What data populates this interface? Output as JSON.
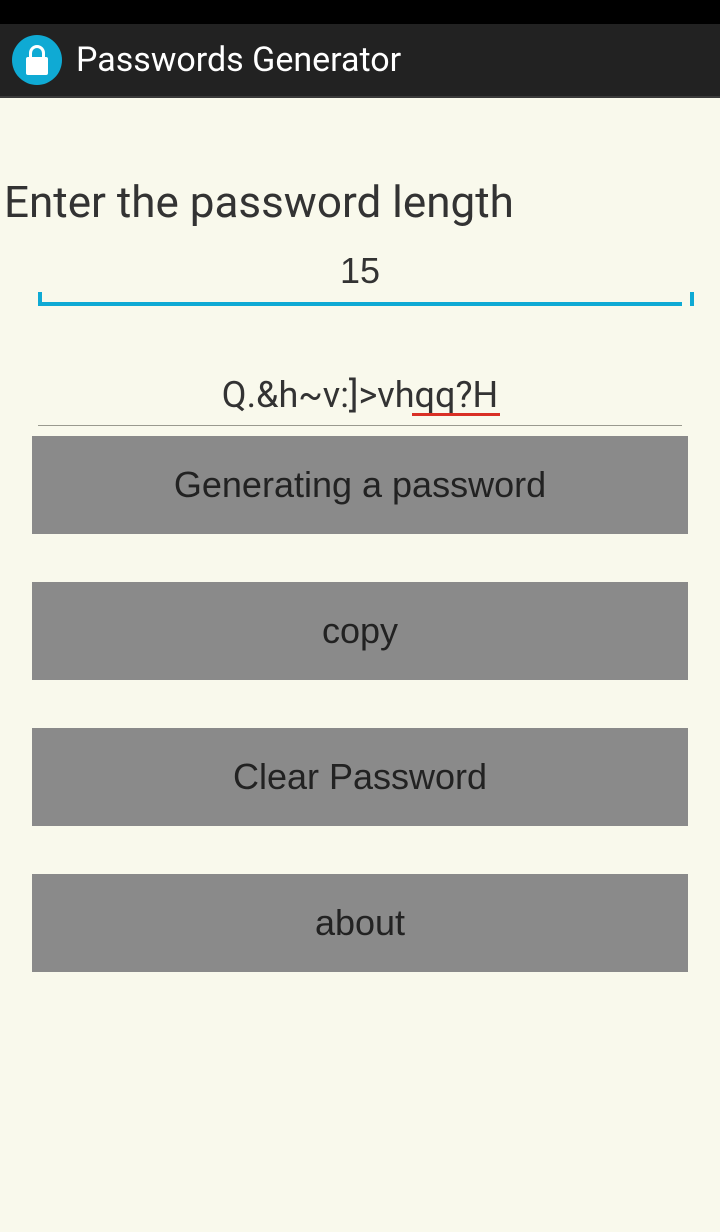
{
  "header": {
    "title": "Passwords Generator"
  },
  "label": "Enter the password length",
  "length_value": "15",
  "password_value": "Q.&h~v:]>vhqq?H",
  "buttons": {
    "generate": "Generating a password",
    "copy": "copy",
    "clear": "Clear Password",
    "about": "about"
  }
}
